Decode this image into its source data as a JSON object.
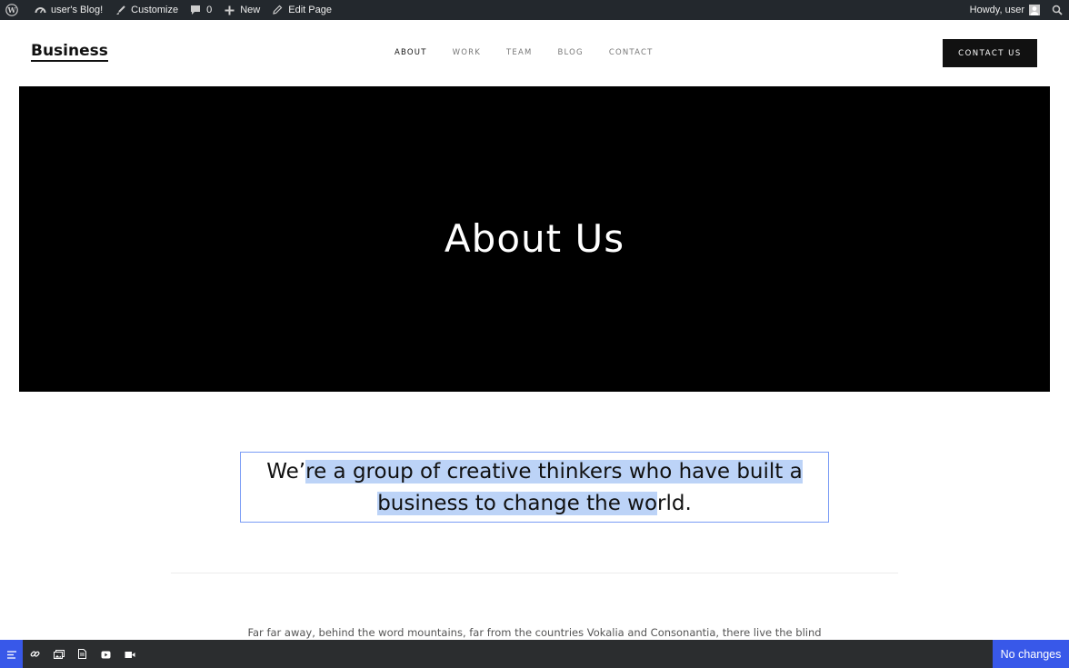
{
  "admin_bar": {
    "wp_logo_icon": "wordpress-icon",
    "site_name": "user's Blog!",
    "customize": "Customize",
    "comments_count": "0",
    "new": "New",
    "edit_page": "Edit Page",
    "howdy": "Howdy, user"
  },
  "header": {
    "logo": "Business",
    "nav": [
      "ABOUT",
      "WORK",
      "TEAM",
      "BLOG",
      "CONTACT"
    ],
    "active_nav": "ABOUT",
    "cta": "CONTACT US"
  },
  "hero": {
    "title": "About Us"
  },
  "intro": {
    "before": "We’",
    "selected_line1": "re a group of creative thinkers who have built a",
    "selected_line2": "business to change the wo",
    "after": "rld."
  },
  "paragraph": "Far far away, behind the word mountains, far from the countries Vokalia and Consonantia, there live the blind",
  "editor_toolbar": {
    "tools": [
      "text-icon",
      "link-icon",
      "gallery-icon",
      "file-icon",
      "youtube-icon",
      "video-icon"
    ],
    "status": "No changes"
  },
  "colors": {
    "admin_bg": "#23282d",
    "accent": "#3858e9",
    "selection": "#bcd3f7"
  }
}
